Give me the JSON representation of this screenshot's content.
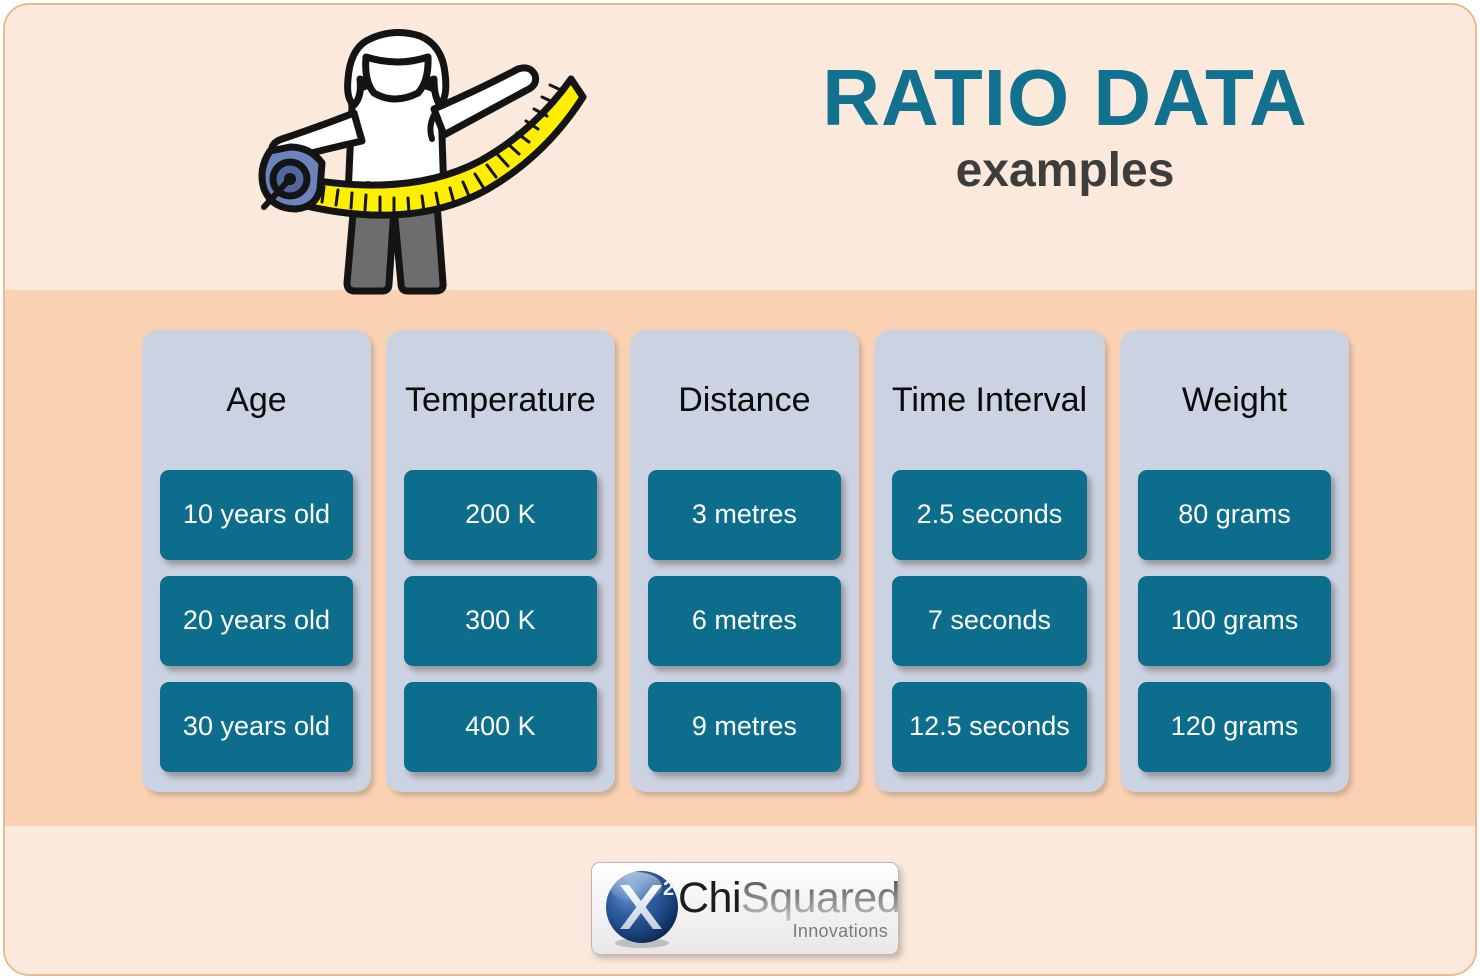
{
  "header": {
    "title": "RATIO DATA",
    "subtitle": "examples"
  },
  "illustration": {
    "name": "person-with-measuring-tape",
    "colors": {
      "tape": "#ffee00",
      "case": "#6c83bc",
      "shirt": "#ffffff",
      "trousers": "#6d6d6d",
      "outline": "#141414"
    }
  },
  "colors": {
    "band_top": "#fbe9dc",
    "band_mid": "#fad2b3",
    "band_bottom": "#fbe9dc",
    "card_bg": "#cbd2e2",
    "pill_bg": "#0c6e8c",
    "title_accent": "#12718e",
    "subtitle": "#3d3d3b",
    "panel_border": "#e9bb92"
  },
  "columns": [
    {
      "header": "Age",
      "values": [
        "10 years old",
        "20 years old",
        "30 years old"
      ]
    },
    {
      "header": "Temperature",
      "values": [
        "200 K",
        "300 K",
        "400 K"
      ]
    },
    {
      "header": "Distance",
      "values": [
        "3 metres",
        "6 metres",
        "9 metres"
      ]
    },
    {
      "header": "Time Interval",
      "values": [
        "2.5 seconds",
        "7 seconds",
        "12.5 seconds"
      ]
    },
    {
      "header": "Weight",
      "values": [
        "80 grams",
        "100 grams",
        "120 grams"
      ]
    }
  ],
  "logo": {
    "mark": "chi-squared-sphere",
    "word_primary": "Chi",
    "word_secondary": "Squared",
    "tagline": "Innovations"
  }
}
